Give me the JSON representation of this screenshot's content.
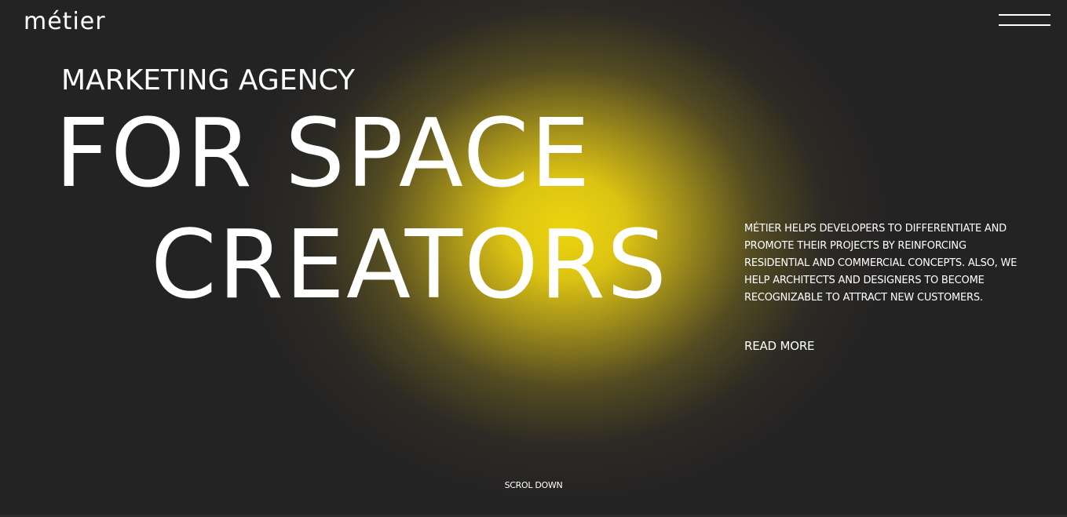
{
  "header": {
    "logo_text": "métier",
    "menu_icon": "hamburger-menu-icon"
  },
  "hero": {
    "subtitle": "MARKETING AGENCY",
    "headline_line1": "FOR SPACE",
    "headline_line2": "CREATORS",
    "description": "MÉTIER HELPS DEVELOPERS TO DIFFERENTIATE AND PROMOTE THEIR PROJECTS BY REINFORCING RESIDENTIAL AND COMMERCIAL CONCEPTS. ALSO, WE HELP ARCHITECTS AND DESIGNERS TO BECOME RECOGNIZABLE TO ATTRACT NEW CUSTOMERS.",
    "read_more_label": "READ MORE",
    "scroll_label": "SCROL DOWN"
  },
  "colors": {
    "background": "#242324",
    "glow": "#ecd410",
    "text": "#ffffff"
  }
}
